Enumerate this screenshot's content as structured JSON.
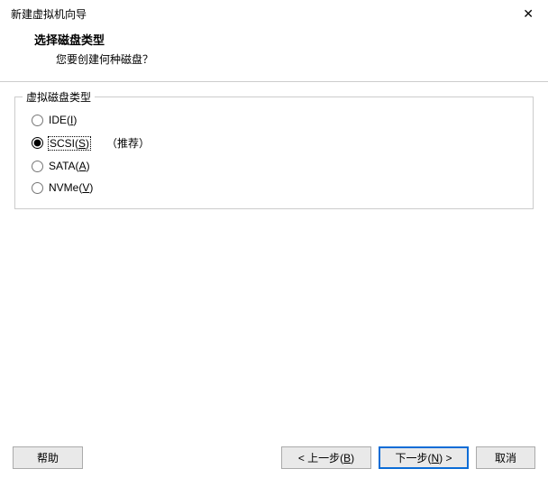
{
  "window": {
    "title": "新建虚拟机向导"
  },
  "header": {
    "title": "选择磁盘类型",
    "subtitle": "您要创建何种磁盘？"
  },
  "fieldset": {
    "legend": "虚拟磁盘类型"
  },
  "options": {
    "ide": {
      "prefix": "IDE(",
      "mnemonic": "I",
      "suffix": ")"
    },
    "scsi": {
      "prefix": "SCSI(",
      "mnemonic": "S",
      "suffix": ")"
    },
    "sata": {
      "prefix": "SATA(",
      "mnemonic": "A",
      "suffix": ")"
    },
    "nvme": {
      "prefix": "NVMe(",
      "mnemonic": "V",
      "suffix": ")"
    }
  },
  "selected": "scsi",
  "recommendation": "（推荐）",
  "buttons": {
    "help": "帮助",
    "back_prefix": "< 上一步(",
    "back_mnemonic": "B",
    "back_suffix": ")",
    "next_prefix": "下一步(",
    "next_mnemonic": "N",
    "next_suffix": ") >",
    "cancel": "取消"
  }
}
